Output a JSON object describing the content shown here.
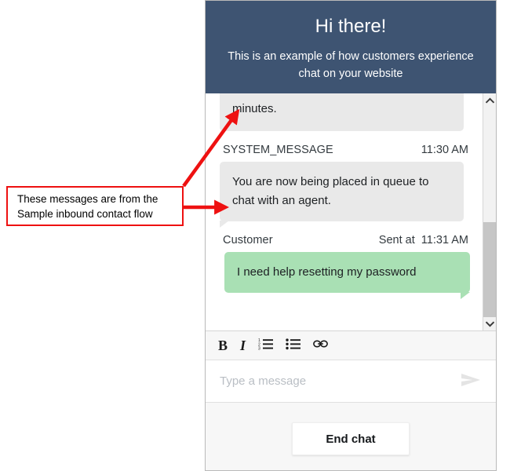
{
  "widget": {
    "header": {
      "greeting": "Hi there!",
      "subtitle": "This is an example of how customers experience chat on your website"
    },
    "messages": [
      {
        "id": "msg-clipped",
        "role": "system",
        "sender": "",
        "time": "",
        "text": "minutes.",
        "clipped": true
      },
      {
        "id": "msg-system-queue",
        "role": "system",
        "sender": "SYSTEM_MESSAGE",
        "time": "11:30 AM",
        "text": "You are now being placed in queue to chat with an agent.",
        "clipped": false
      },
      {
        "id": "msg-customer-password",
        "role": "customer",
        "sender": "Customer",
        "time": "Sent at  11:31 AM",
        "text": "I need help resetting my password",
        "clipped": false
      }
    ],
    "toolbar": {
      "bold_label": "B",
      "italic_label": "I",
      "ordered_list_label": "ordered-list",
      "unordered_list_label": "unordered-list",
      "link_label": "link"
    },
    "composer": {
      "value": "",
      "placeholder": "Type a message",
      "send_label": "send"
    },
    "footer": {
      "end_chat_label": "End chat"
    },
    "scrollbar": {
      "up_label": "scroll-up",
      "down_label": "scroll-down"
    }
  },
  "annotation": {
    "text_line_1": "These messages are from the",
    "text_line_2": "Sample inbound contact flow"
  },
  "colors": {
    "header_bg": "#3e5472",
    "system_bubble": "#e9e9e9",
    "customer_bubble": "#a9e0b4",
    "annotation_red": "#ee1111",
    "footer_bg": "#f7f7f7"
  }
}
